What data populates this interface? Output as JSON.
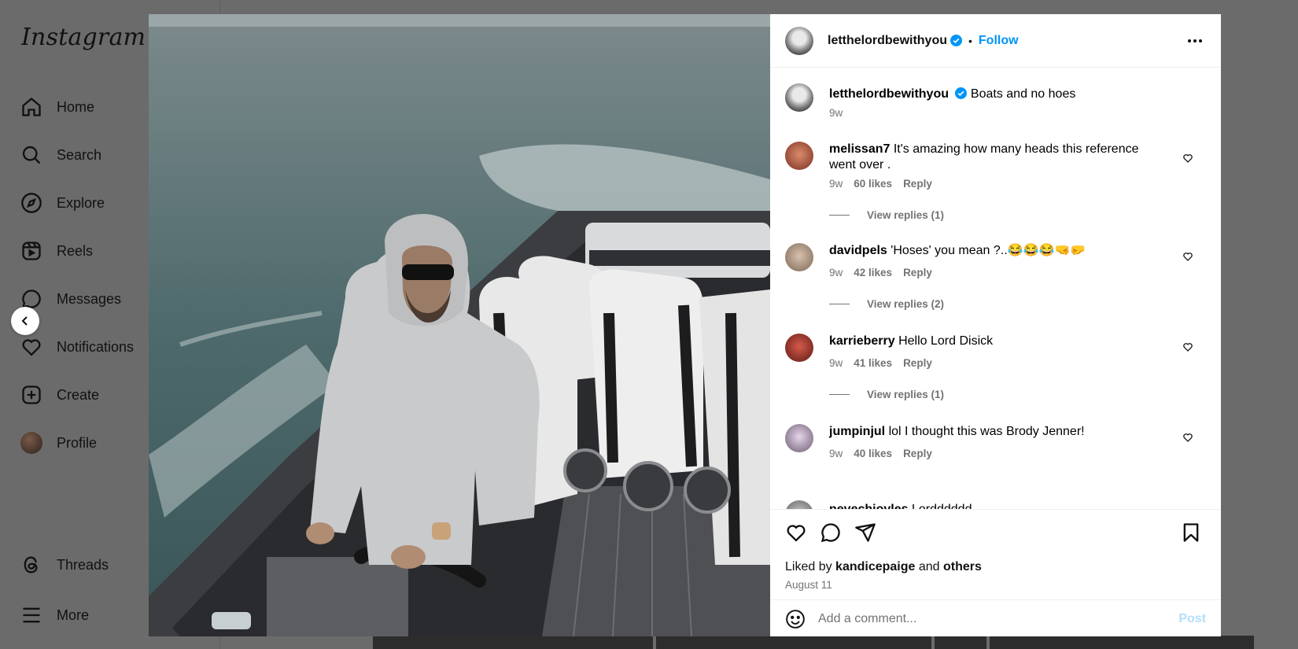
{
  "brand": "Instagram",
  "nav": [
    {
      "label": "Home",
      "icon": "home-icon"
    },
    {
      "label": "Search",
      "icon": "search-icon"
    },
    {
      "label": "Explore",
      "icon": "explore-icon"
    },
    {
      "label": "Reels",
      "icon": "reels-icon"
    },
    {
      "label": "Messages",
      "icon": "messages-icon"
    },
    {
      "label": "Notifications",
      "icon": "heart-icon"
    },
    {
      "label": "Create",
      "icon": "plus-square-icon"
    },
    {
      "label": "Profile",
      "icon": "profile-avatar"
    },
    {
      "label": "Threads",
      "icon": "threads-icon"
    },
    {
      "label": "More",
      "icon": "menu-icon"
    }
  ],
  "post": {
    "author": "letthelordbewithyou",
    "follow_label": "Follow",
    "dot": "•",
    "caption": "Boats and no hoes",
    "caption_time": "9w"
  },
  "comments": [
    {
      "user": "melissan7",
      "text": "It's amazing how many heads this reference went over .",
      "time": "9w",
      "likes": "60 likes",
      "reply": "Reply",
      "replies": "View replies (1)"
    },
    {
      "user": "davidpels",
      "text": "'Hoses' you mean ?..😂😂😂🤜🤛",
      "time": "9w",
      "likes": "42 likes",
      "reply": "Reply",
      "replies": "View replies (2)"
    },
    {
      "user": "karrieberry",
      "text": "Hello Lord Disick",
      "time": "9w",
      "likes": "41 likes",
      "reply": "Reply",
      "replies": "View replies (1)"
    },
    {
      "user": "jumpinjul",
      "text": "lol I thought this was Brody Jenner!",
      "time": "9w",
      "likes": "40 likes",
      "reply": "Reply"
    },
    {
      "user": "nevechiovles",
      "text": "Lordddddd"
    }
  ],
  "likes": {
    "prefix": "Liked by",
    "user": "kandicepaige",
    "connector": "and",
    "others": "others"
  },
  "date": "August 11",
  "add_comment": {
    "placeholder": "Add a comment...",
    "post_label": "Post"
  },
  "colors": {
    "accent": "#0095f6",
    "verified": "#0095f6",
    "muted": "#737373"
  }
}
